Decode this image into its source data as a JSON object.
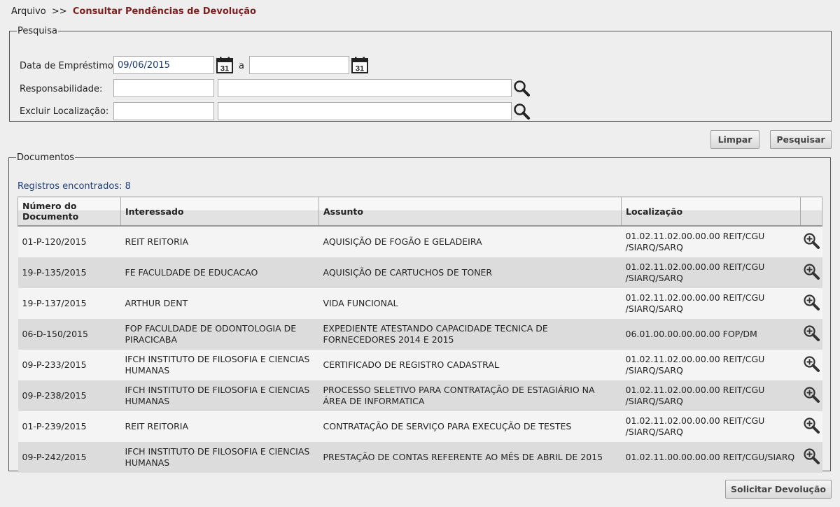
{
  "breadcrumb": {
    "root": "Arquivo",
    "separator": ">>",
    "current": "Consultar Pendências de Devolução"
  },
  "search": {
    "legend": "Pesquisa",
    "date_label": "Data de Empréstimo:",
    "date_from": "09/06/2015",
    "date_to": "",
    "range_sep": "a",
    "calendar_day": "31",
    "resp_label": "Responsabilidade:",
    "resp_code": "",
    "resp_name": "",
    "excl_label": "Excluir Localização:",
    "excl_code": "",
    "excl_name": ""
  },
  "actions": {
    "clear": "Limpar",
    "search": "Pesquisar",
    "request_return": "Solicitar Devolução"
  },
  "documents": {
    "legend": "Documentos",
    "count_text": "Registros encontrados: 8",
    "columns": [
      "Número do Documento",
      "Interessado",
      "Assunto",
      "Localização",
      ""
    ],
    "rows": [
      {
        "numero": "01-P-120/2015",
        "interessado": "REIT REITORIA",
        "assunto": "AQUISIÇÃO DE FOGÃO E GELADEIRA",
        "localizacao": "01.02.11.02.00.00.00 REIT/CGU /SIARQ/SARQ"
      },
      {
        "numero": "19-P-135/2015",
        "interessado": "FE FACULDADE DE EDUCACAO",
        "assunto": "AQUISIÇÃO DE CARTUCHOS DE TONER",
        "localizacao": "01.02.11.02.00.00.00 REIT/CGU /SIARQ/SARQ"
      },
      {
        "numero": "19-P-137/2015",
        "interessado": "ARTHUR DENT",
        "assunto": "VIDA FUNCIONAL",
        "localizacao": "01.02.11.02.00.00.00 REIT/CGU /SIARQ/SARQ"
      },
      {
        "numero": "06-D-150/2015",
        "interessado": "FOP FACULDADE DE ODONTOLOGIA DE PIRACICABA",
        "assunto": "EXPEDIENTE ATESTANDO CAPACIDADE TECNICA DE FORNECEDORES 2014 E 2015",
        "localizacao": "06.01.00.00.00.00.00 FOP/DM"
      },
      {
        "numero": "09-P-233/2015",
        "interessado": "IFCH INSTITUTO DE FILOSOFIA E CIENCIAS HUMANAS",
        "assunto": "CERTIFICADO DE REGISTRO CADASTRAL",
        "localizacao": "01.02.11.02.00.00.00 REIT/CGU /SIARQ/SARQ"
      },
      {
        "numero": "09-P-238/2015",
        "interessado": "IFCH INSTITUTO DE FILOSOFIA E CIENCIAS HUMANAS",
        "assunto": "PROCESSO SELETIVO PARA CONTRATAÇÃO DE ESTAGIÁRIO NA ÁREA DE INFORMATICA",
        "localizacao": "01.02.11.02.00.00.00 REIT/CGU /SIARQ/SARQ"
      },
      {
        "numero": "01-P-239/2015",
        "interessado": "REIT REITORIA",
        "assunto": "CONTRATAÇÃO DE SERVIÇO PARA EXECUÇÃO DE TESTES",
        "localizacao": "01.02.11.02.00.00.00 REIT/CGU /SIARQ/SARQ"
      },
      {
        "numero": "09-P-242/2015",
        "interessado": "IFCH INSTITUTO DE FILOSOFIA E CIENCIAS HUMANAS",
        "assunto": "PRESTAÇÃO DE CONTAS REFERENTE AO MÊS DE ABRIL DE 2015",
        "localizacao": "01.02.11.00.00.00.00 REIT/CGU/SIARQ"
      }
    ]
  },
  "icons": {
    "calendar": "calendar-icon",
    "lookup": "search-icon",
    "view": "zoom-in-icon"
  },
  "colors": {
    "breadcrumb_current": "#7b1f1f",
    "count_text": "#1e3f7a",
    "row_even": "#dcdcdc",
    "row_odd": "#f4f4f4"
  }
}
